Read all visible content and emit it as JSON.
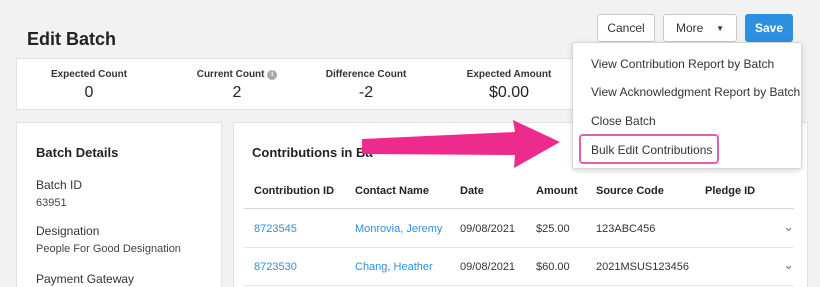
{
  "header": {
    "title": "Edit Batch",
    "cancel_label": "Cancel",
    "more_label": "More",
    "save_label": "Save"
  },
  "stats": [
    {
      "label": "Expected Count",
      "value": "0"
    },
    {
      "label": "Current Count",
      "value": "2"
    },
    {
      "label": "Difference Count",
      "value": "-2"
    },
    {
      "label": "Expected Amount",
      "value": "$0.00"
    }
  ],
  "details": {
    "title": "Batch Details",
    "fields": [
      {
        "label": "Batch ID",
        "value": "63951"
      },
      {
        "label": "Designation",
        "value": "People For Good Designation"
      },
      {
        "label": "Payment Gateway",
        "value": ""
      }
    ]
  },
  "contributions": {
    "title": "Contributions in Ba",
    "columns": [
      "Contribution ID",
      "Contact Name",
      "Date",
      "Amount",
      "Source Code",
      "Pledge ID"
    ],
    "rows": [
      {
        "id": "8723545",
        "name": "Monrovia, Jeremy",
        "date": "09/08/2021",
        "amount": "$25.00",
        "source": "123ABC456",
        "pledge": ""
      },
      {
        "id": "8723530",
        "name": "Chang, Heather",
        "date": "09/08/2021",
        "amount": "$60.00",
        "source": "2021MSUS123456",
        "pledge": ""
      }
    ]
  },
  "more_menu": {
    "items": [
      "View Contribution Report by Batch",
      "View Acknowledgment Report by Batch",
      "Close Batch",
      "Bulk Edit Contributions"
    ],
    "highlighted_index": 3
  },
  "colors": {
    "accent": "#2d8fe0",
    "highlight": "#e060b0",
    "arrow": "#ec2b8c"
  },
  "icons": {
    "info": "info-icon",
    "caret": "caret-down-icon",
    "row_expand": "chevron-down-icon",
    "annotation": "arrow-right-icon"
  }
}
